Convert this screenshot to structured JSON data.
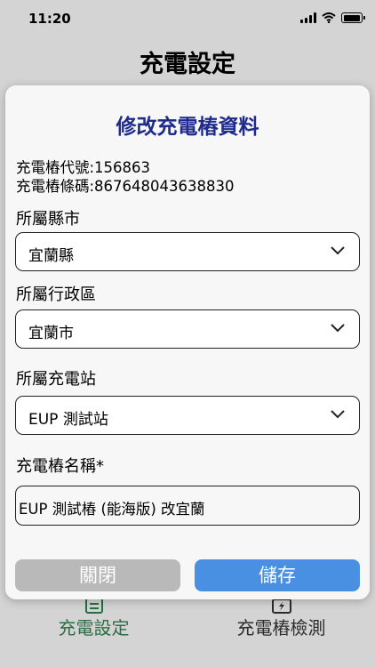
{
  "status_bar": {
    "time": "11:20"
  },
  "header": {
    "title": "充電設定"
  },
  "tabs": [
    {
      "label": "充電設定",
      "icon": "document-icon",
      "active": true
    },
    {
      "label": "充電樁檢測",
      "icon": "battery-charge-icon",
      "active": false
    }
  ],
  "modal": {
    "title": "修改充電樁資料",
    "charger_code": "充電樁代號:156863",
    "charger_barcode": "充電樁條碼:867648043638830",
    "city": {
      "label": "所屬縣市",
      "value": "宜蘭縣"
    },
    "district": {
      "label": "所屬行政區",
      "value": "宜蘭市"
    },
    "station": {
      "label": "所屬充電站",
      "value": "EUP 測試站"
    },
    "name": {
      "label": "充電樁名稱*",
      "value": "EUP 測試樁 (能海版) 改宜蘭"
    },
    "close_label": "關閉",
    "save_label": "儲存"
  },
  "colors": {
    "title": "#1f2b8c",
    "save": "#4a90e2",
    "close": "#b9b9b9",
    "active_tab": "#2f7d4d"
  }
}
